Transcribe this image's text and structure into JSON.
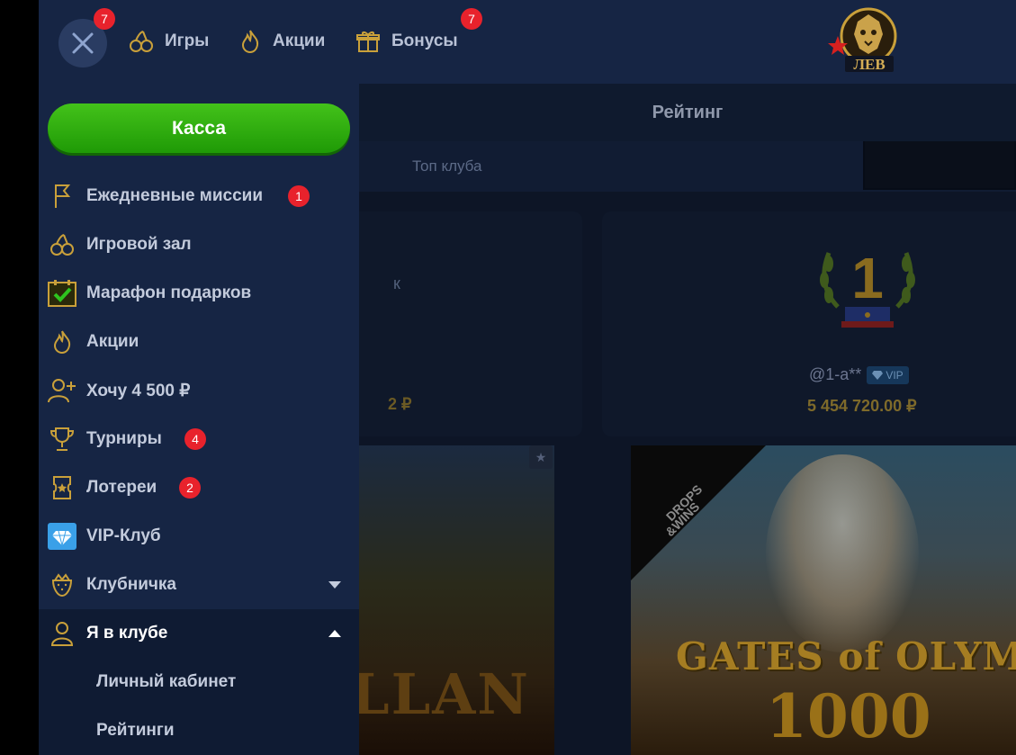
{
  "header": {
    "close_badge": "7",
    "nav": [
      {
        "label": "Игры",
        "icon": "cherries-icon"
      },
      {
        "label": "Акции",
        "icon": "flame-icon"
      },
      {
        "label": "Бонусы",
        "icon": "gift-icon",
        "badge": "7"
      }
    ],
    "logo_text": "ЛЕВ"
  },
  "sidebar": {
    "cashier_label": "Касса",
    "items": [
      {
        "label": "Ежедневные миссии",
        "icon": "flag-icon",
        "badge": "1"
      },
      {
        "label": "Игровой зал",
        "icon": "cherries-icon"
      },
      {
        "label": "Марафон подарков",
        "icon": "calendar-check-icon"
      },
      {
        "label": "Акции",
        "icon": "flame-icon"
      },
      {
        "label": "Хочу 4 500 ₽",
        "icon": "add-user-icon"
      },
      {
        "label": "Турниры",
        "icon": "trophy-icon",
        "badge": "4"
      },
      {
        "label": "Лотереи",
        "icon": "ticket-icon",
        "badge": "2"
      },
      {
        "label": "VIP-Клуб",
        "icon": "diamond-icon"
      },
      {
        "label": "Клубничка",
        "icon": "strawberry-icon",
        "expanded": false
      },
      {
        "label": "Я в клубе",
        "icon": "user-icon",
        "expanded": true
      }
    ],
    "sub_items": [
      "Личный кабинет",
      "Рейтинги"
    ]
  },
  "content": {
    "ratings_title": "Рейтинг",
    "tab_label": "Топ клуба",
    "left_card": {
      "partial_text": "к",
      "amount_fragment": "2 ₽"
    },
    "top_player": {
      "rank": "1",
      "username": "@1-a**",
      "tag": "VIP",
      "amount": "5 454 720.00 ₽"
    },
    "games": [
      {
        "title_fragment": "LLAN"
      },
      {
        "title": "GATES of OLYMPU",
        "subtitle": "1000",
        "ribbon": "DROPS & WINS"
      }
    ]
  },
  "colors": {
    "header_bg": "#162544",
    "accent_green": "#2fae0f",
    "badge_red": "#e8222c",
    "gold": "#c9a03a"
  }
}
